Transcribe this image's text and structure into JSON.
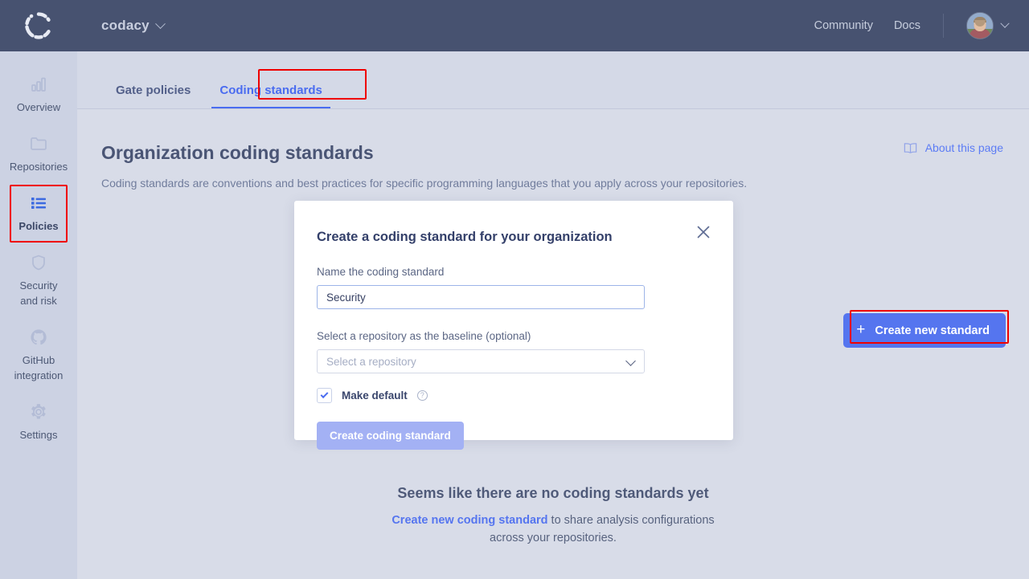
{
  "topbar": {
    "logo_icon": "codacy-logo-icon",
    "org_name": "codacy",
    "org_chevron_icon": "chevron-down-icon",
    "links": [
      {
        "label": "Community",
        "name": "community-link"
      },
      {
        "label": "Docs",
        "name": "docs-link"
      }
    ],
    "avatar_icon": "user-avatar",
    "avatar_chevron_icon": "chevron-down-icon"
  },
  "sidebar": {
    "items": [
      {
        "label": "Overview",
        "icon": "bar-chart-icon",
        "active": false
      },
      {
        "label": "Repositories",
        "icon": "folder-icon",
        "active": false
      },
      {
        "label": "Policies",
        "icon": "list-icon",
        "active": true
      },
      {
        "label": "Security\nand risk",
        "icon": "shield-icon",
        "active": false
      },
      {
        "label": "GitHub\nintegration",
        "icon": "github-icon",
        "active": false
      },
      {
        "label": "Settings",
        "icon": "gear-icon",
        "active": false
      }
    ]
  },
  "tabs": [
    {
      "label": "Gate policies",
      "active": false
    },
    {
      "label": "Coding standards",
      "active": true
    }
  ],
  "page": {
    "title": "Organization coding standards",
    "subtitle": "Coding standards are conventions and best practices for specific programming languages that you apply across your repositories.",
    "about_link": "About this page",
    "about_icon": "book-icon",
    "create_button": "Create new standard",
    "create_button_icon": "plus-icon"
  },
  "empty_state": {
    "title": "Seems like there are no coding standards yet",
    "link": "Create new coding standard",
    "text_after": " to share analysis configurations",
    "text_line2": "across your repositories."
  },
  "modal": {
    "title": "Create a coding standard for your organization",
    "close_icon": "close-icon",
    "name_label": "Name the coding standard",
    "name_value": "Security",
    "name_placeholder": "Name the coding standard",
    "repo_label": "Select a repository as the baseline  (optional)",
    "repo_placeholder": "Select a repository",
    "repo_chevron_icon": "chevron-down-icon",
    "checkbox_label": "Make default",
    "checkbox_checked": true,
    "checkbox_help_icon": "help-circle-icon",
    "submit_label": "Create coding standard"
  },
  "colors": {
    "topbar_bg": "#475270",
    "sidebar_bg": "#ccd2e3",
    "page_bg": "#d8dce8",
    "accent_blue": "#4a6cf0",
    "primary_button": "#5575ef",
    "disabled_button": "#a3b1f4",
    "highlight_red": "#ef0000"
  }
}
